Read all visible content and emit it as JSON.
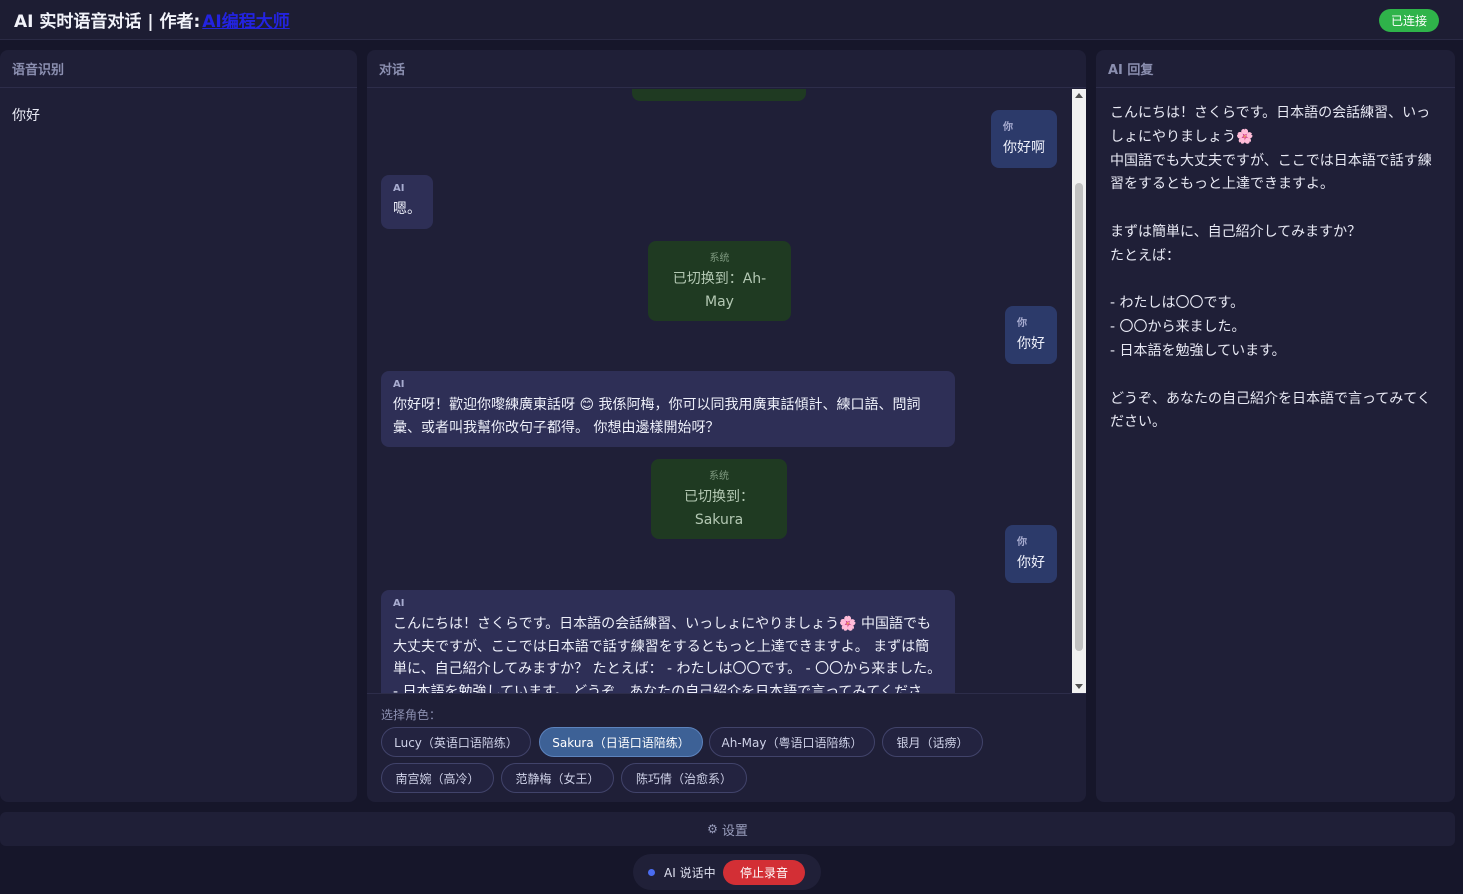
{
  "header": {
    "title": "AI 实时语音对话 | 作者:",
    "author_link": "AI编程大师",
    "status_badge": "已连接"
  },
  "panels": {
    "recognition": {
      "title": "语音识别",
      "text": "你好"
    },
    "conversation": {
      "title": "对话"
    },
    "reply": {
      "title": "AI 回复",
      "text": "こんにちは！さくらです。日本語の会話練習、いっしょにやりましょう🌸\n中国語でも大丈夫ですが、ここでは日本語で話す練習をするともっと上達できますよ。\n\nまずは簡単に、自己紹介してみますか？\nたとえば：\n\n- わたしは〇〇です。\n- 〇〇から来ました。\n- 日本語を勉強しています。\n\nどうぞ、あなたの自己紹介を日本語で言ってみてください。"
    }
  },
  "messages": [
    {
      "role": "user",
      "label": "你",
      "text": "你好啊"
    },
    {
      "role": "ai",
      "label": "AI",
      "text": "嗯。"
    },
    {
      "role": "system",
      "label": "系统",
      "text": "已切换到：Ah-May"
    },
    {
      "role": "user",
      "label": "你",
      "text": "你好"
    },
    {
      "role": "ai",
      "label": "AI",
      "text": "你好呀！歡迎你嚟練廣東話呀 😊 我係阿梅，你可以同我用廣東話傾計、練口語、問詞彙、或者叫我幫你改句子都得。 你想由邊樣開始呀？"
    },
    {
      "role": "system",
      "label": "系统",
      "text": "已切换到：Sakura"
    },
    {
      "role": "user",
      "label": "你",
      "text": "你好"
    },
    {
      "role": "ai",
      "label": "AI",
      "text": "こんにちは！さくらです。日本語の会話練習、いっしょにやりましょう🌸 中国語でも大丈夫ですが、ここでは日本語で話す練習をするともっと上達できますよ。 まずは簡単に、自己紹介してみますか？ たとえば： - わたしは〇〇です。 - 〇〇から来ました。 - 日本語を勉強しています。 どうぞ、あなたの自己紹介を日本語で言ってみてください。"
    }
  ],
  "roles": {
    "label": "选择角色：",
    "items": [
      {
        "label": "Lucy（英语口语陪练）",
        "active": false
      },
      {
        "label": "Sakura（日语口语陪练）",
        "active": true
      },
      {
        "label": "Ah-May（粤语口语陪练）",
        "active": false
      },
      {
        "label": "银月（话痨）",
        "active": false
      },
      {
        "label": "南宫婉（高冷）",
        "active": false
      },
      {
        "label": "范静梅（女王）",
        "active": false
      },
      {
        "label": "陈巧倩（治愈系）",
        "active": false
      }
    ]
  },
  "settings": {
    "icon": "gear-icon",
    "label": "设置"
  },
  "footer": {
    "status": "AI 说话中",
    "stop_button": "停止录音"
  },
  "colors": {
    "background": "#16162a",
    "panel": "#1f1f37",
    "connected": "#2fb34a",
    "stop": "#d32f35",
    "active_role": "#3d6196",
    "user_bubble": "#2c3a6a",
    "ai_bubble": "#2e2f56",
    "system_bubble": "#1f3a22"
  }
}
